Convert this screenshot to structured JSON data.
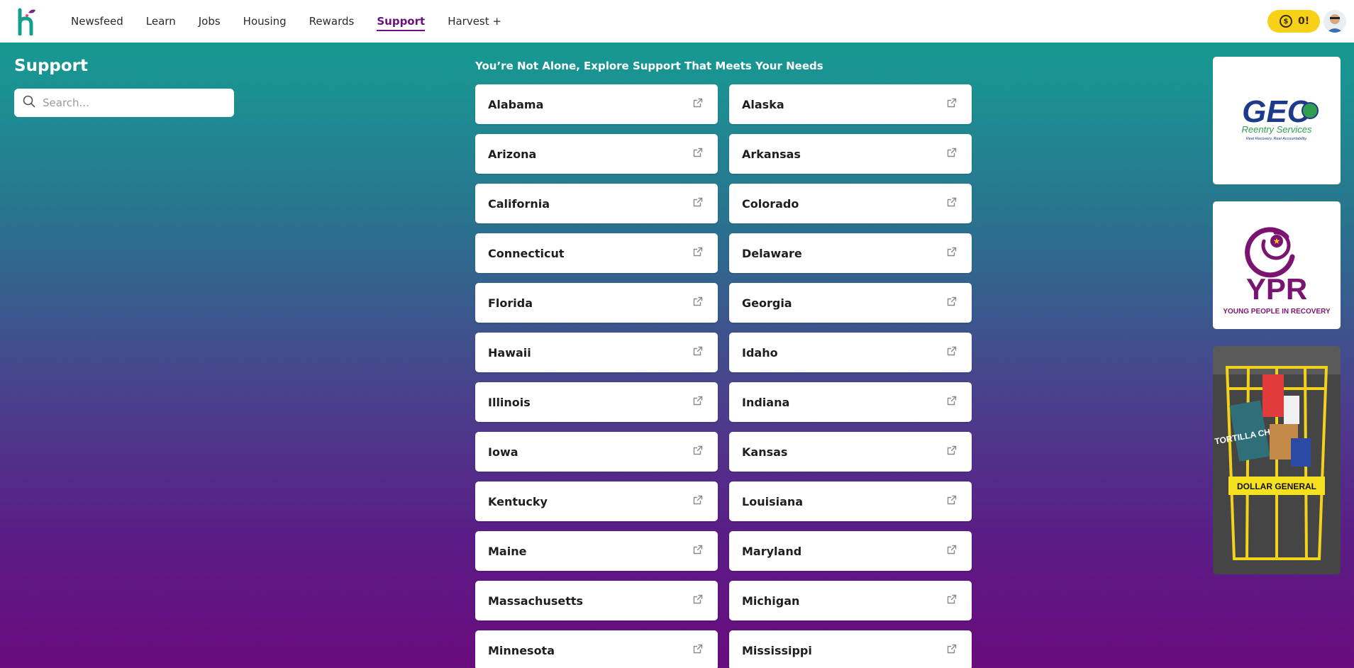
{
  "nav": {
    "items": [
      {
        "label": "Newsfeed",
        "active": false
      },
      {
        "label": "Learn",
        "active": false
      },
      {
        "label": "Jobs",
        "active": false
      },
      {
        "label": "Housing",
        "active": false
      },
      {
        "label": "Rewards",
        "active": false
      },
      {
        "label": "Support",
        "active": true
      },
      {
        "label": "Harvest +",
        "active": false
      }
    ],
    "coins": "0!"
  },
  "sidebar": {
    "title": "Support",
    "search_placeholder": "Search..."
  },
  "main": {
    "heading": "You’re Not Alone, Explore Support That Meets Your Needs",
    "states": [
      "Alabama",
      "Alaska",
      "Arizona",
      "Arkansas",
      "California",
      "Colorado",
      "Connecticut",
      "Delaware",
      "Florida",
      "Georgia",
      "Hawaii",
      "Idaho",
      "Illinois",
      "Indiana",
      "Iowa",
      "Kansas",
      "Kentucky",
      "Louisiana",
      "Maine",
      "Maryland",
      "Massachusetts",
      "Michigan",
      "Minnesota",
      "Mississippi"
    ]
  },
  "ads": {
    "geo": {
      "brand": "GEO",
      "line1": "Reentry Services",
      "line2": "Real Recovery. Real Accountability."
    },
    "ypr": {
      "brand": "YPR",
      "line1": "YOUNG PEOPLE IN RECOVERY"
    },
    "dg": {
      "brand": "DOLLAR GENERAL",
      "chips": "TORTILLA CHIPS"
    }
  },
  "colors": {
    "accent": "#6b1180",
    "coin": "#f7d117",
    "teal": "#119e8e"
  }
}
